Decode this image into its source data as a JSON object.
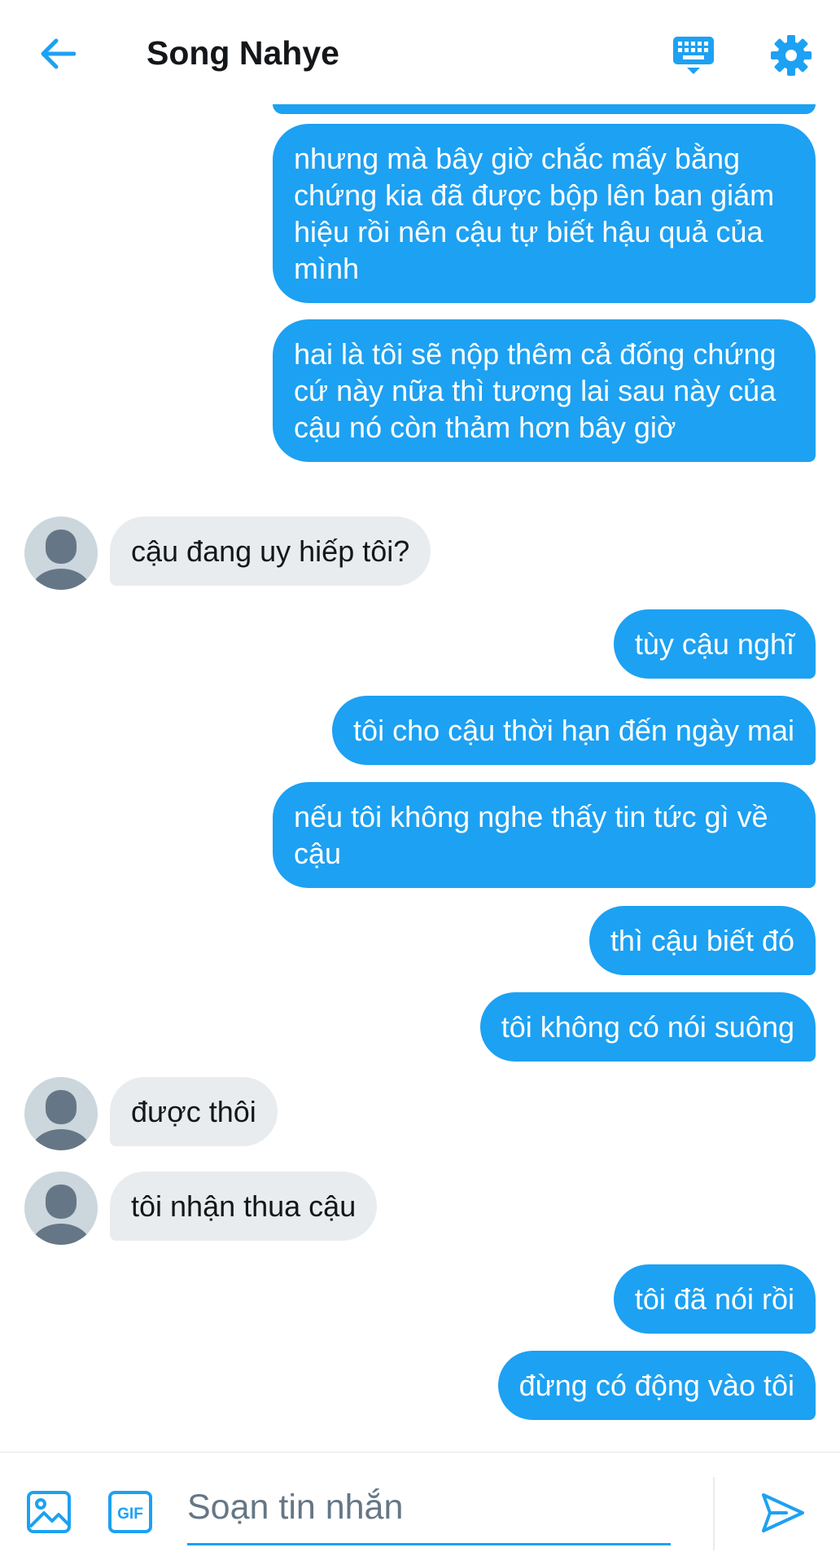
{
  "header": {
    "title": "Song Nahye",
    "back_icon": "arrow-left-icon",
    "keyboard_icon": "keyboard-icon",
    "settings_icon": "gear-icon"
  },
  "colors": {
    "accent": "#1da1f2",
    "incoming_bubble": "#e9ecef",
    "avatar_bg": "#ccd6dd",
    "avatar_figure": "#657786"
  },
  "messages": [
    {
      "direction": "out",
      "text": "nhưng mà bây giờ chắc mấy bằng chứng kia đã được bộp lên ban giám hiệu rồi nên cậu tự biết hậu quả của mình"
    },
    {
      "direction": "out",
      "text": "hai là tôi sẽ nộp thêm cả đống chứng cứ này nữa thì tương lai sau này của cậu nó còn thảm hơn bây giờ"
    },
    {
      "direction": "in",
      "text": "cậu đang uy hiếp tôi?"
    },
    {
      "direction": "out",
      "text": "tùy cậu nghĩ"
    },
    {
      "direction": "out",
      "text": "tôi cho cậu thời hạn đến ngày mai"
    },
    {
      "direction": "out",
      "text": "nếu tôi không nghe thấy tin tức gì về cậu"
    },
    {
      "direction": "out",
      "text": "thì cậu biết đó"
    },
    {
      "direction": "out",
      "text": "tôi không có nói suông"
    },
    {
      "direction": "in",
      "text": "được thôi"
    },
    {
      "direction": "in",
      "text": "tôi nhận thua cậu"
    },
    {
      "direction": "out",
      "text": "tôi đã nói rồi"
    },
    {
      "direction": "out",
      "text": "đừng có động vào tôi"
    }
  ],
  "composer": {
    "placeholder": "Soạn tin nhắn",
    "image_icon": "image-icon",
    "gif_label": "GIF",
    "send_icon": "send-icon"
  }
}
